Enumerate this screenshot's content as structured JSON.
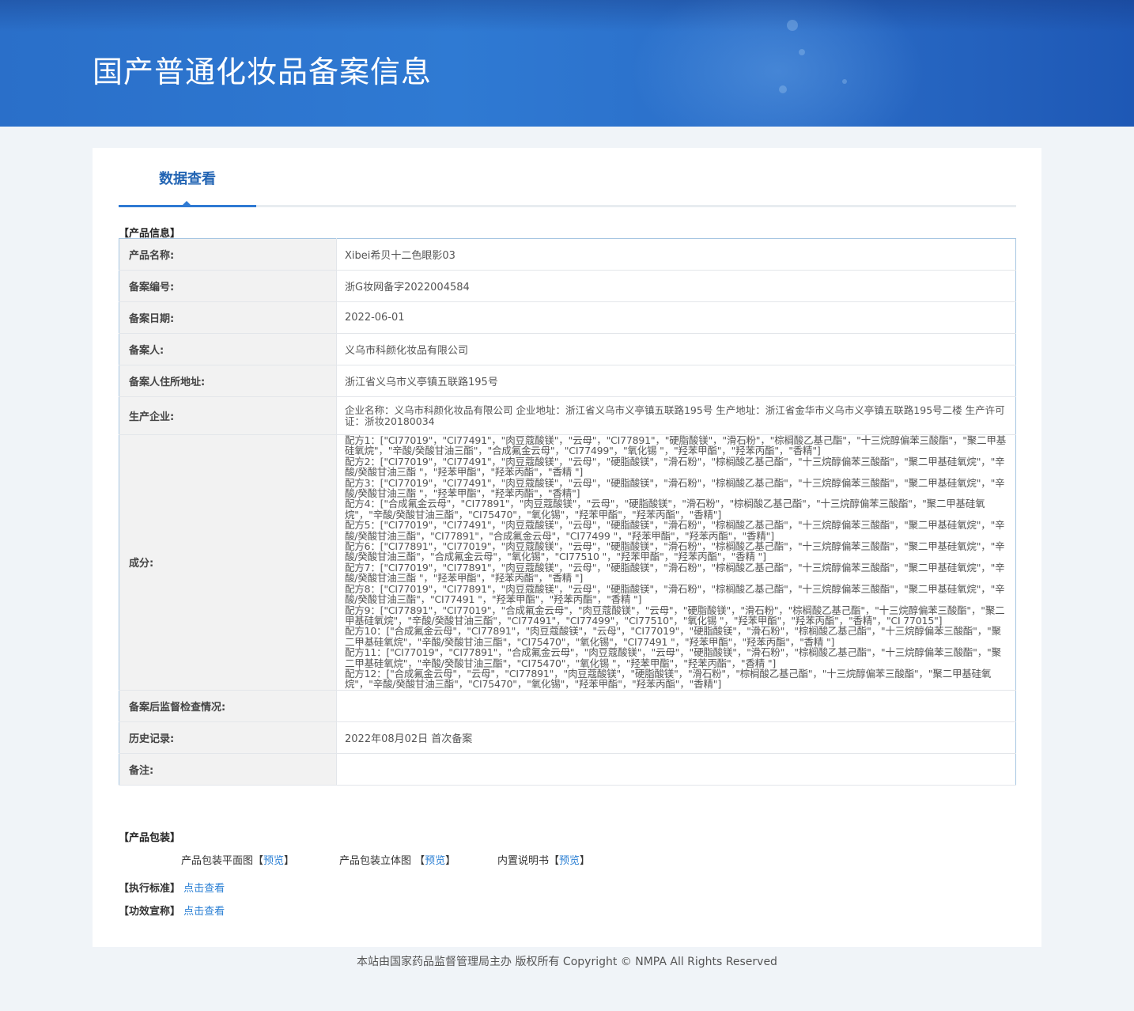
{
  "header": {
    "title": "国产普通化妆品备案信息"
  },
  "tabs": [
    {
      "label": "数据查看"
    }
  ],
  "product_info": {
    "section_label": "【产品信息】",
    "rows": [
      {
        "key": "产品名称:",
        "value": "Xibei希贝十二色眼影03"
      },
      {
        "key": "备案编号:",
        "value": "浙G妆网备字2022004584"
      },
      {
        "key": "备案日期:",
        "value": "2022-06-01"
      },
      {
        "key": "备案人:",
        "value": "义乌市科颜化妆品有限公司"
      },
      {
        "key": "备案人住所地址:",
        "value": "浙江省义乌市义亭镇五联路195号"
      },
      {
        "key": "生产企业:",
        "value": "企业名称：义乌市科颜化妆品有限公司 企业地址：浙江省义乌市义亭镇五联路195号 生产地址：浙江省金华市义乌市义亭镇五联路195号二楼 生产许可证：浙妆20180034"
      },
      {
        "key": "成分:",
        "value": "配方1：[\"CI77019\"，\"CI77491\"，\"肉豆蔻酸镁\"，\"云母\"，\"CI77891\"，\"硬脂酸镁\"，\"滑石粉\"，\"棕榈酸乙基己酯\"，\"十三烷醇偏苯三酸酯\"，\"聚二甲基硅氧烷\"，\"辛酸/癸酸甘油三酯\"，\"合成氟金云母\"，\"CI77499\"，\"氧化锡 \"，\"羟苯甲酯\"，\"羟苯丙酯\"，\"香精\"]\n配方2：[\"CI77019\"，\"CI77491\"，\"肉豆蔻酸镁\"，\"云母\"，\"硬脂酸镁\"，\"滑石粉\"，\"棕榈酸乙基己酯\"，\"十三烷醇偏苯三酸酯\"，\"聚二甲基硅氧烷\"，\"辛酸/癸酸甘油三酯 \"，\"羟苯甲酯\"，\"羟苯丙酯\"，\"香精 \"]\n配方3：[\"CI77019\"，\"CI77491\"，\"肉豆蔻酸镁\"，\"云母\"，\"硬脂酸镁\"，\"滑石粉\"，\"棕榈酸乙基己酯\"，\"十三烷醇偏苯三酸酯\"，\"聚二甲基硅氧烷\"，\"辛酸/癸酸甘油三酯 \"，\"羟苯甲酯\"，\"羟苯丙酯\"，\"香精\"]\n配方4：[\"合成氟金云母\"，\"CI77891\"，\"肉豆蔻酸镁\"，\"云母\"，\"硬脂酸镁\"，\"滑石粉\"，\"棕榈酸乙基己酯\"，\"十三烷醇偏苯三酸酯\"，\"聚二甲基硅氧烷\"，\"辛酸/癸酸甘油三酯\"，\"CI75470\"，\"氧化锡\"，\"羟苯甲酯\"，\"羟苯丙酯\"，\"香精\"]\n配方5：[\"CI77019\"，\"CI77491\"，\"肉豆蔻酸镁\"，\"云母\"，\"硬脂酸镁\"，\"滑石粉\"，\"棕榈酸乙基己酯\"，\"十三烷醇偏苯三酸酯\"，\"聚二甲基硅氧烷\"，\"辛酸/癸酸甘油三酯\"，\"CI77891\"，\"合成氟金云母\"，\"CI77499 \"，\"羟苯甲酯\"，\"羟苯丙酯\"，\"香精\"]\n配方6：[\"CI77891\"，\"CI77019\"，\"肉豆蔻酸镁\"，\"云母\"，\"硬脂酸镁\"，\"滑石粉\"，\"棕榈酸乙基己酯\"，\"十三烷醇偏苯三酸酯\"，\"聚二甲基硅氧烷\"，\"辛酸/癸酸甘油三酯\"，\"合成氟金云母\"，\"氧化锡\"，\"CI77510 \"，\"羟苯甲酯\"，\"羟苯丙酯\"，\"香精 \"]\n配方7：[\"CI77019\"，\"CI77891\"，\"肉豆蔻酸镁\"，\"云母\"，\"硬脂酸镁\"，\"滑石粉\"，\"棕榈酸乙基己酯\"，\"十三烷醇偏苯三酸酯\"，\"聚二甲基硅氧烷\"，\"辛酸/癸酸甘油三酯 \"，\"羟苯甲酯\"，\"羟苯丙酯\"，\"香精 \"]\n配方8：[\"CI77019\"，\"CI77891\"，\"肉豆蔻酸镁\"，\"云母\"，\"硬脂酸镁\"，\"滑石粉\"，\"棕榈酸乙基己酯\"，\"十三烷醇偏苯三酸酯\"，\"聚二甲基硅氧烷\"，\"辛酸/癸酸甘油三酯\"，\"CI77491 \"，\"羟苯甲酯\"，\"羟苯丙酯\"，\"香精 \"]\n配方9：[\"CI77891\"，\"CI77019\"，\"合成氟金云母\"，\"肉豆蔻酸镁\"，\"云母\"，\"硬脂酸镁\"，\"滑石粉\"，\"棕榈酸乙基己酯\"，\"十三烷醇偏苯三酸酯\"，\"聚二甲基硅氧烷\"，\"辛酸/癸酸甘油三酯\"，\"CI77491\"，\"CI77499\"，\"CI77510\"，\"氧化锡 \"，\"羟苯甲酯\"，\"羟苯丙酯\"，\"香精\"，\"CI 77015\"]\n配方10：[\"合成氟金云母\"，\"CI77891\"，\"肉豆蔻酸镁\"，\"云母\"，\"CI77019\"，\"硬脂酸镁\"，\"滑石粉\"，\"棕榈酸乙基己酯\"，\"十三烷醇偏苯三酸酯\"，\"聚二甲基硅氧烷\"，\"辛酸/癸酸甘油三酯\"，\"CI75470\"，\"氧化锡\"，\"CI77491 \"，\"羟苯甲酯\"，\"羟苯丙酯\"，\"香精 \"]\n配方11：[\"CI77019\"，\"CI77891\"，\"合成氟金云母\"，\"肉豆蔻酸镁\"，\"云母\"，\"硬脂酸镁\"，\"滑石粉\"，\"棕榈酸乙基己酯\"，\"十三烷醇偏苯三酸酯\"，\"聚二甲基硅氧烷\"，\"辛酸/癸酸甘油三酯\"，\"CI75470\"，\"氧化锡 \"，\"羟苯甲酯\"，\"羟苯丙酯\"，\"香精 \"]\n配方12：[\"合成氟金云母\"，\"云母\"，\"CI77891\"，\"肉豆蔻酸镁\"，\"硬脂酸镁\"，\"滑石粉\"，\"棕榈酸乙基己酯\"，\"十三烷醇偏苯三酸酯\"，\"聚二甲基硅氧烷\"，\"辛酸/癸酸甘油三酯\"，\"CI75470\"，\"氧化锡\"，\"羟苯甲酯\"，\"羟苯丙酯\"，\"香精\"]"
      },
      {
        "key": "备案后监督检查情况:",
        "value": ""
      },
      {
        "key": "历史记录:",
        "value": "2022年08月02日 首次备案"
      },
      {
        "key": "备注:",
        "value": ""
      }
    ]
  },
  "packaging": {
    "section_label": "【产品包装】",
    "items": [
      {
        "label": "产品包装平面图",
        "link": "预览"
      },
      {
        "label": "产品包装立体图 ",
        "link": "预览"
      },
      {
        "label": "内置说明书",
        "link": "预览"
      }
    ]
  },
  "standard": {
    "label": "【执行标准】",
    "link": "点击查看"
  },
  "efficacy": {
    "label": "【功效宣称】",
    "link": "点击查看"
  },
  "footer": {
    "text": "本站由国家药品监督管理局主办 版权所有 Copyright © NMPA All Rights Reserved"
  }
}
